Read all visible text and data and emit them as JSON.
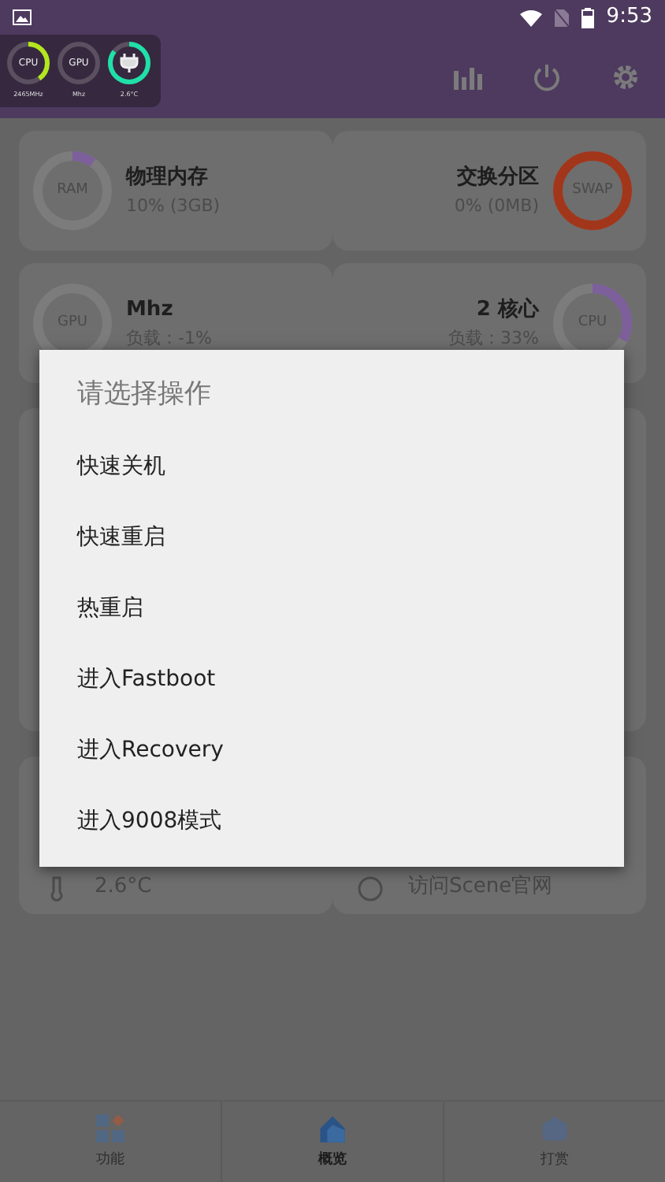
{
  "status_bar": {
    "time": "9:53"
  },
  "floating_monitor": {
    "gauges": [
      {
        "kind": "text",
        "label": "CPU",
        "reading": "2465MHz",
        "level": 0.4,
        "color": "#b4e61e"
      },
      {
        "kind": "text",
        "label": "GPU",
        "reading": "Mhz"
      },
      {
        "kind": "icon",
        "reading": "2.6°C",
        "level": 0.85,
        "color": "#1fe0a8"
      }
    ]
  },
  "cards": [
    {
      "gauge": "RAM",
      "title": "物理内存",
      "detail": "10% (3GB)",
      "level": 0.1,
      "color": "#7d5f9c"
    },
    {
      "gauge": "SWAP",
      "title": "交换分区",
      "detail": "0% (0MB)",
      "level": 1,
      "color": "#a2361b"
    },
    {
      "gauge": "GPU",
      "title": "Mhz",
      "detail": "负载：-1%",
      "level": 0
    },
    {
      "gauge": "CPU",
      "title": "2 核心",
      "detail": "负载：33%",
      "level": 0.33,
      "color": "#7d5f9c"
    }
  ],
  "hidden_cards": [
    {
      "text": "2.6°C"
    },
    {
      "text": "访问Scene官网"
    }
  ],
  "dialog": {
    "title": "请选择操作",
    "items": [
      "快速关机",
      "快速重启",
      "热重启",
      "进入Fastboot",
      "进入Recovery",
      "进入9008模式"
    ]
  },
  "bottom_nav": [
    {
      "label": "功能",
      "selected": false
    },
    {
      "label": "概览",
      "selected": true
    },
    {
      "label": "打赏",
      "selected": false
    }
  ]
}
